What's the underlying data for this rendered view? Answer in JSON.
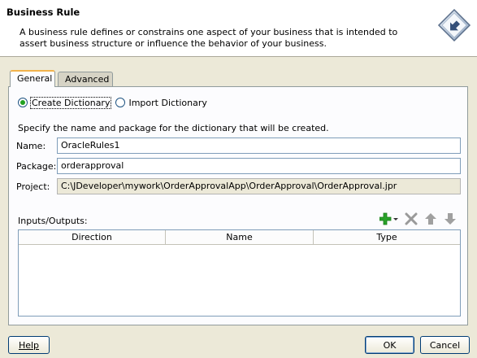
{
  "header": {
    "title": "Business Rule",
    "description": "A business rule defines or constrains one aspect of your business that is intended to assert business structure or influence the behavior of your business.",
    "logo_icon": "business-rule-diamond-icon"
  },
  "tabs": [
    {
      "label": "General",
      "selected": true
    },
    {
      "label": "Advanced",
      "selected": false
    }
  ],
  "dictionary_options": [
    {
      "label": "Create Dictionary",
      "selected": true
    },
    {
      "label": "Import Dictionary",
      "selected": false
    }
  ],
  "instruction": "Specify the name and package for the dictionary that will be created.",
  "fields": {
    "name": {
      "label": "Name:",
      "value": "OracleRules1"
    },
    "package": {
      "label": "Package:",
      "value": "orderapproval"
    },
    "project": {
      "label": "Project:",
      "value": "C:\\JDeveloper\\mywork\\OrderApprovalApp\\OrderApproval\\OrderApproval.jpr"
    }
  },
  "io": {
    "label": "Inputs/Outputs:",
    "toolbar": [
      "add-icon",
      "delete-icon",
      "move-up-icon",
      "move-down-icon"
    ],
    "columns": [
      "Direction",
      "Name",
      "Type"
    ],
    "rows": []
  },
  "buttons": {
    "help": "Help",
    "ok": "OK",
    "cancel": "Cancel"
  },
  "colors": {
    "add_green": "#2aa22a",
    "tab_highlight": "#f2b34c",
    "radio_dot": "#21a121"
  }
}
